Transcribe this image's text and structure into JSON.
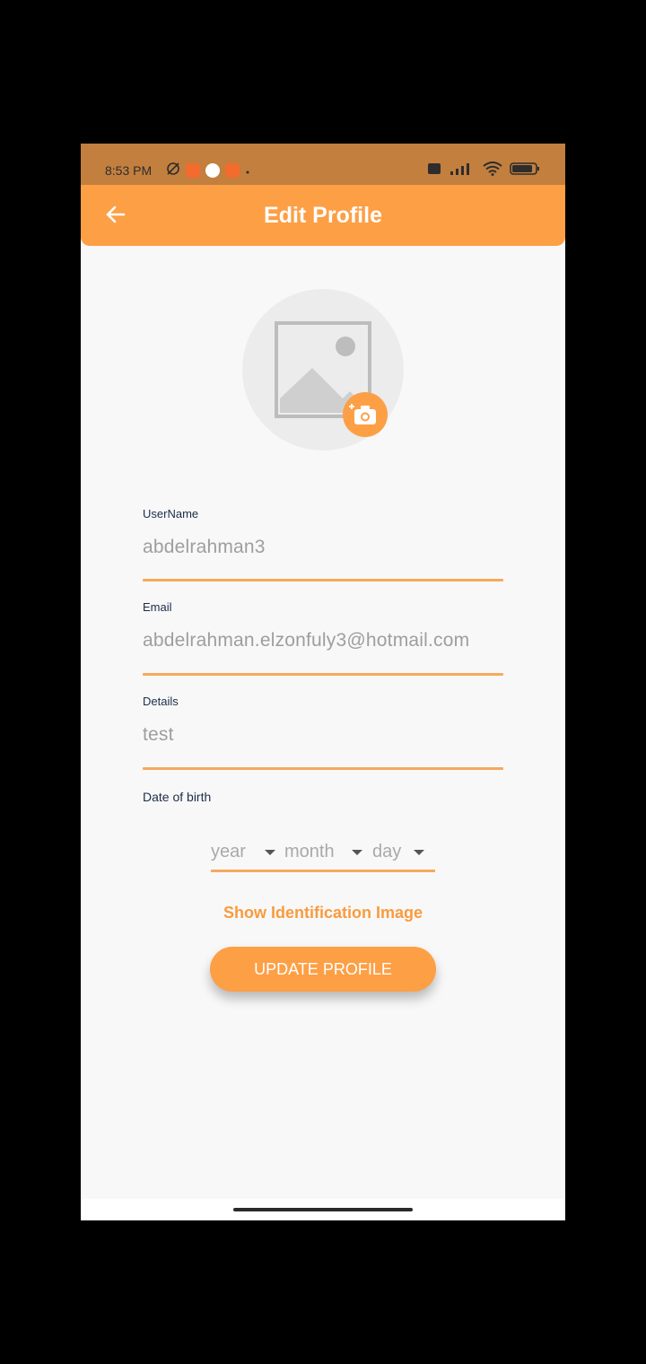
{
  "status_bar": {
    "time": "8:53 PM",
    "icons_left": [
      "mute-icon",
      "screen-record-icon",
      "camera-app-icon",
      "video-call-icon",
      "dot-icon"
    ],
    "icons_right": [
      "volte-icon",
      "signal-icon",
      "wifi-icon",
      "battery-icon"
    ],
    "battery_text": "85"
  },
  "app_bar": {
    "title": "Edit Profile",
    "back_icon": "arrow-left-icon",
    "color": "#fd9f45"
  },
  "avatar": {
    "placeholder_icon": "image-placeholder-icon",
    "edit_icon": "camera-add-icon"
  },
  "form": {
    "username": {
      "label": "UserName",
      "value": "abdelrahman3"
    },
    "email": {
      "label": "Email",
      "value": "abdelrahman.elzonfuly3@hotmail.com"
    },
    "details": {
      "label": "Details",
      "value": "test"
    },
    "dob": {
      "label": "Date of birth",
      "year_placeholder": "year",
      "month_placeholder": "month",
      "day_placeholder": "day"
    }
  },
  "actions": {
    "show_id_label": "Show Identification Image",
    "update_label": "UPDATE PROFILE"
  },
  "colors": {
    "accent": "#fd9f45",
    "underline": "#f6a95d",
    "label": "#1d2c4a",
    "value": "#9e9e9e"
  }
}
